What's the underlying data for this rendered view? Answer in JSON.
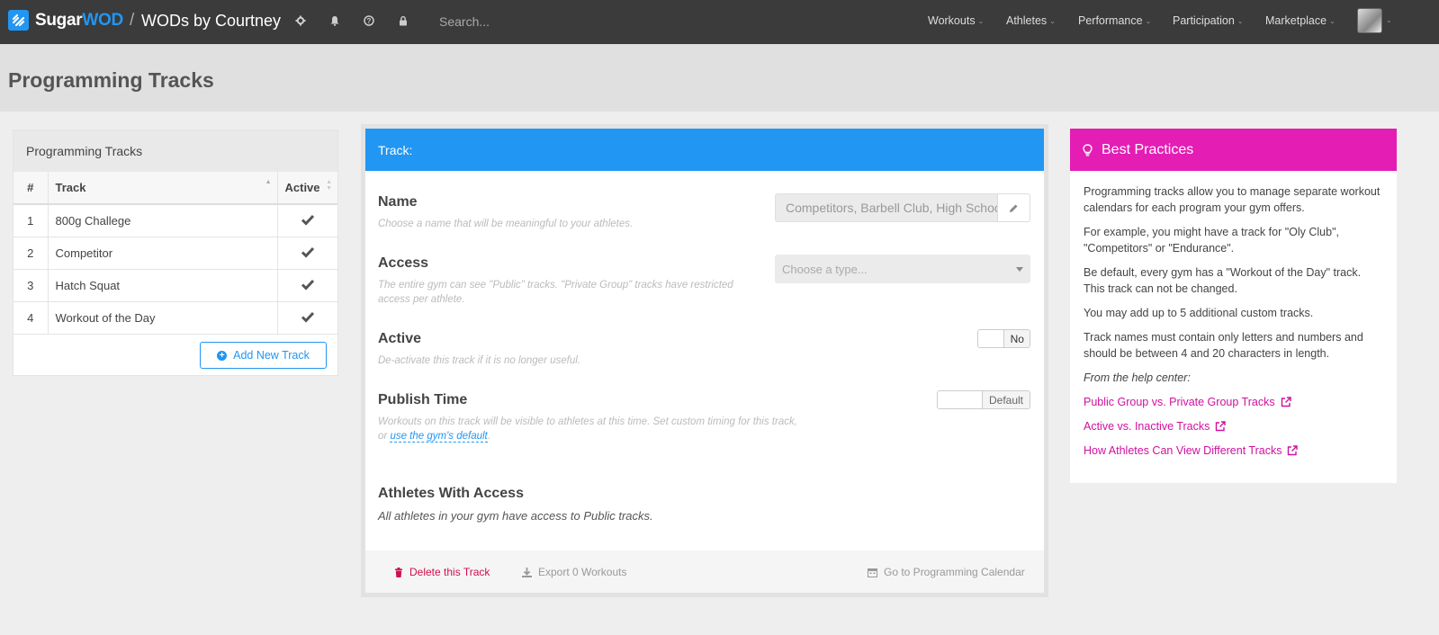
{
  "topbar": {
    "brand_sugar": "Sugar",
    "brand_wod": "WOD",
    "separator": "/",
    "gym_name": "WODs by Courtney",
    "search_placeholder": "Search...",
    "nav": [
      {
        "label": "Workouts"
      },
      {
        "label": "Athletes"
      },
      {
        "label": "Performance"
      },
      {
        "label": "Participation"
      },
      {
        "label": "Marketplace"
      }
    ],
    "icons": [
      "gear-icon",
      "bell-icon",
      "question-icon",
      "lock-icon"
    ]
  },
  "page": {
    "title": "Programming Tracks"
  },
  "tracks_panel": {
    "title": "Programming Tracks",
    "columns": {
      "num": "#",
      "track": "Track",
      "active": "Active"
    },
    "rows": [
      {
        "num": "1",
        "track": "800g Challege",
        "active": true
      },
      {
        "num": "2",
        "track": "Competitor",
        "active": true
      },
      {
        "num": "3",
        "track": "Hatch Squat",
        "active": true
      },
      {
        "num": "4",
        "track": "Workout of the Day",
        "active": true
      }
    ],
    "add_button": "Add New Track"
  },
  "track_form": {
    "header": "Track:",
    "name_label": "Name",
    "name_help": "Choose a name that will be meaningful to your athletes.",
    "name_value": "Competitors, Barbell Club, High School",
    "access_label": "Access",
    "access_help": "The entire gym can see \"Public\" tracks. \"Private Group\" tracks have restricted access per athlete.",
    "access_placeholder": "Choose a type...",
    "active_label": "Active",
    "active_help": "De-activate this track if it is no longer useful.",
    "active_toggle": "No",
    "publish_label": "Publish Time",
    "publish_help": "Workouts on this track will be visible to athletes at this time. Set custom timing for this track,",
    "publish_help_or": "or",
    "publish_help_link": "use the gym's default",
    "publish_help_end": ".",
    "publish_toggle": "Default",
    "athletes_label": "Athletes With Access",
    "athletes_note": "All athletes in your gym have access to Public tracks.",
    "delete_link": "Delete this Track",
    "export_link": "Export 0 Workouts",
    "calendar_link": "Go to Programming Calendar"
  },
  "best_practices": {
    "title": "Best Practices",
    "paragraphs": [
      "Programming tracks allow you to manage separate workout calendars for each program your gym offers.",
      "For example, you might have a track for \"Oly Club\", \"Competitors\" or \"Endurance\".",
      "Be default, every gym has a \"Workout of the Day\" track. This track can not be changed.",
      "You may add up to 5 additional custom tracks.",
      "Track names must contain only letters and numbers and should be between 4 and 20 characters in length."
    ],
    "from_help": "From the help center:",
    "links": [
      "Public Group vs. Private Group Tracks",
      "Active vs. Inactive Tracks",
      "How Athletes Can View Different Tracks"
    ]
  },
  "colors": {
    "topbar": "#3b3b3b",
    "primary": "#2196f3",
    "best_practices": "#e41db4",
    "danger": "#d0104c"
  }
}
